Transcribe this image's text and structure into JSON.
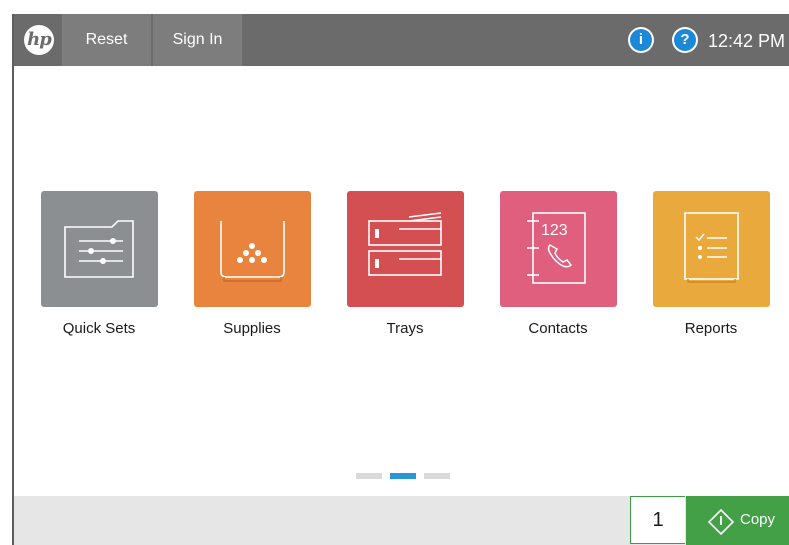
{
  "header": {
    "logo_text": "hp",
    "reset_label": "Reset",
    "sign_in_label": "Sign In",
    "info_symbol": "i",
    "help_symbol": "?",
    "time": "12:42 PM"
  },
  "apps": [
    {
      "label": "Quick Sets",
      "icon": "folder-sliders-icon",
      "color": "#8c8f91"
    },
    {
      "label": "Supplies",
      "icon": "toner-icon",
      "color": "#e9843e"
    },
    {
      "label": "Trays",
      "icon": "paper-trays-icon",
      "color": "#d44f51"
    },
    {
      "label": "Contacts",
      "icon": "address-book-icon",
      "color": "#e05e7e",
      "icon_text": "123"
    },
    {
      "label": "Reports",
      "icon": "checklist-icon",
      "color": "#e9a93c"
    }
  ],
  "pager": {
    "pages": 3,
    "active_page": 2
  },
  "bottom_bar": {
    "copies": "1",
    "copy_label": "Copy"
  },
  "colors": {
    "header_bg": "#6b6b6b",
    "header_button_bg": "#7d7d7d",
    "accent_blue": "#1c89d8",
    "copy_green": "#43a047"
  }
}
